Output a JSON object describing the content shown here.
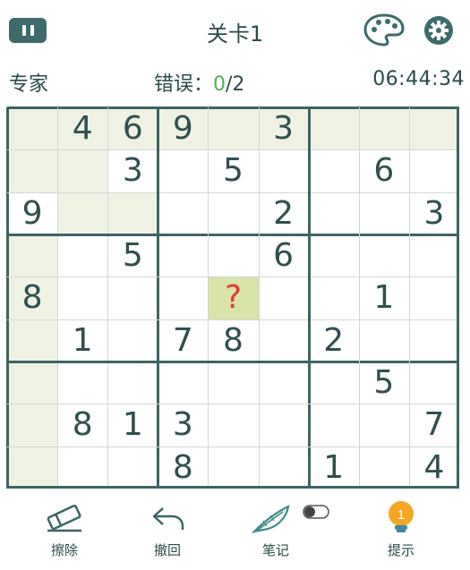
{
  "header": {
    "level_title": "关卡1",
    "pause_icon": "pause-icon",
    "palette_icon": "palette-icon",
    "settings_icon": "gear-icon"
  },
  "status": {
    "difficulty": "专家",
    "errors_label": "错误：",
    "errors_current": "0",
    "errors_max": "/2",
    "timer": "06:44:34"
  },
  "colors": {
    "accent": "#3d6b6b",
    "highlight": "#eff2e2",
    "selected": "#d8e4aa",
    "error_ok": "#4caf50",
    "question": "#e53935",
    "hint_bulb": "#f5a623"
  },
  "board": {
    "selected_cell": "?",
    "rows": [
      [
        "",
        "4",
        "6",
        "9",
        "",
        "3",
        "",
        "",
        ""
      ],
      [
        "",
        "",
        "3",
        "",
        "5",
        "",
        "",
        "6",
        ""
      ],
      [
        "9",
        "",
        "",
        "",
        "",
        "2",
        "",
        "",
        "3"
      ],
      [
        "",
        "",
        "5",
        "",
        "",
        "6",
        "",
        "",
        ""
      ],
      [
        "8",
        "",
        "",
        "",
        "?",
        "",
        "",
        "1",
        ""
      ],
      [
        "",
        "1",
        "",
        "7",
        "8",
        "",
        "2",
        "",
        ""
      ],
      [
        "",
        "",
        "",
        "",
        "",
        "",
        "",
        "5",
        ""
      ],
      [
        "",
        "8",
        "1",
        "3",
        "",
        "",
        "",
        "",
        "7"
      ],
      [
        "",
        "",
        "",
        "8",
        "",
        "",
        "1",
        "",
        "4"
      ]
    ],
    "highlighted": [
      [
        0,
        0
      ],
      [
        0,
        1
      ],
      [
        0,
        2
      ],
      [
        0,
        3
      ],
      [
        0,
        4
      ],
      [
        0,
        5
      ],
      [
        0,
        6
      ],
      [
        0,
        7
      ],
      [
        0,
        8
      ],
      [
        1,
        0
      ],
      [
        1,
        1
      ],
      [
        2,
        1
      ],
      [
        2,
        2
      ],
      [
        3,
        0
      ],
      [
        4,
        0
      ],
      [
        5,
        0
      ],
      [
        6,
        0
      ],
      [
        7,
        0
      ],
      [
        8,
        0
      ]
    ]
  },
  "toolbar": {
    "erase_label": "擦除",
    "undo_label": "撤回",
    "notes_label": "笔记",
    "hint_label": "提示",
    "hint_count": "1"
  }
}
